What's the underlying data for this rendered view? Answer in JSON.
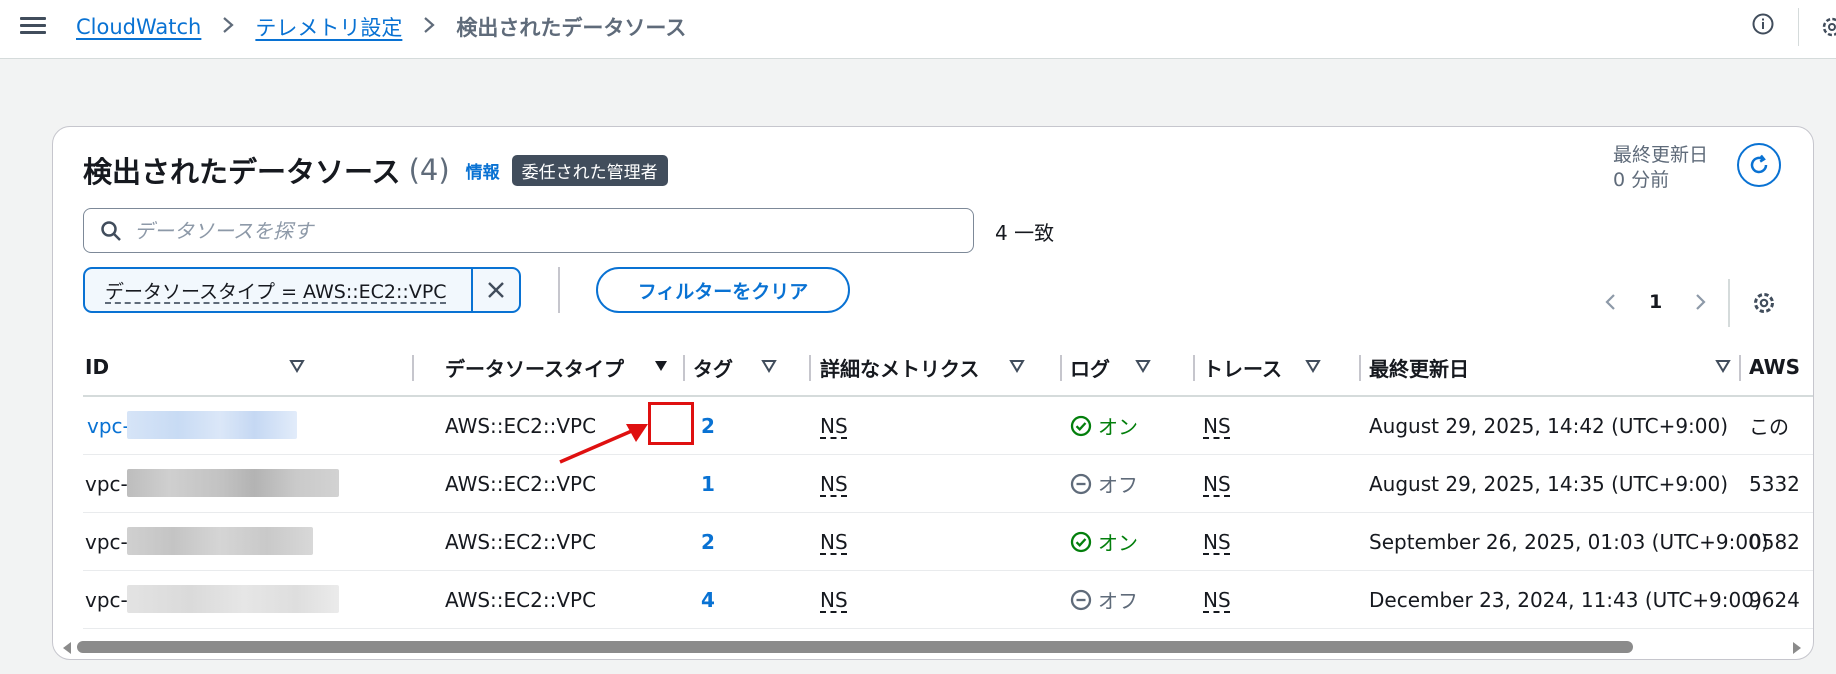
{
  "breadcrumbs": {
    "cloudwatch": "CloudWatch",
    "telemetry": "テレメトリ設定",
    "current": "検出されたデータソース"
  },
  "panel": {
    "title": "検出されたデータソース",
    "count": "(4)",
    "info": "情報",
    "badge": "委任された管理者",
    "updated_label": "最終更新日",
    "updated_value": "0 分前"
  },
  "search": {
    "placeholder": "データソースを探す",
    "value": "",
    "match_count": "4 一致"
  },
  "filter": {
    "token_label": "データソースタイプ = AWS::EC2::VPC",
    "clear_label": "フィルターをクリア"
  },
  "pagination": {
    "current_page": "1"
  },
  "table": {
    "columns": [
      "ID",
      "データソースタイプ",
      "タグ",
      "詳細なメトリクス",
      "ログ",
      "トレース",
      "最終更新日",
      "AWS"
    ],
    "rows": [
      {
        "id": "vpc-",
        "id_link": true,
        "type": "AWS::EC2::VPC",
        "tags": "2",
        "metrics": "NS",
        "log": "オン",
        "log_state": "on",
        "trace": "NS",
        "updated": "August 29, 2025, 14:42 (UTC+9:00)",
        "account": "この"
      },
      {
        "id": "vpc-",
        "id_link": false,
        "type": "AWS::EC2::VPC",
        "tags": "1",
        "metrics": "NS",
        "log": "オフ",
        "log_state": "off",
        "trace": "NS",
        "updated": "August 29, 2025, 14:35 (UTC+9:00)",
        "account": "5332"
      },
      {
        "id": "vpc-",
        "id_link": false,
        "type": "AWS::EC2::VPC",
        "tags": "2",
        "metrics": "NS",
        "log": "オン",
        "log_state": "on",
        "trace": "NS",
        "updated": "September 26, 2025, 01:03 (UTC+9:00)",
        "account": "0582"
      },
      {
        "id": "vpc-",
        "id_link": false,
        "type": "AWS::EC2::VPC",
        "tags": "4",
        "metrics": "NS",
        "log": "オフ",
        "log_state": "off",
        "trace": "NS",
        "updated": "December 23, 2024, 11:43 (UTC+9:00)",
        "account": "9624"
      }
    ]
  },
  "colors": {
    "link": "#0972d3",
    "on": "#037f0c",
    "off": "#5f6b7a",
    "annotation": "#df1010"
  },
  "icons": [
    "menu-icon",
    "chevron-right-icon",
    "info-icon",
    "settings-icon",
    "refresh-icon",
    "search-icon",
    "close-icon",
    "chevron-left-icon",
    "sort-caret-icon",
    "status-positive-icon",
    "status-stopped-icon"
  ]
}
